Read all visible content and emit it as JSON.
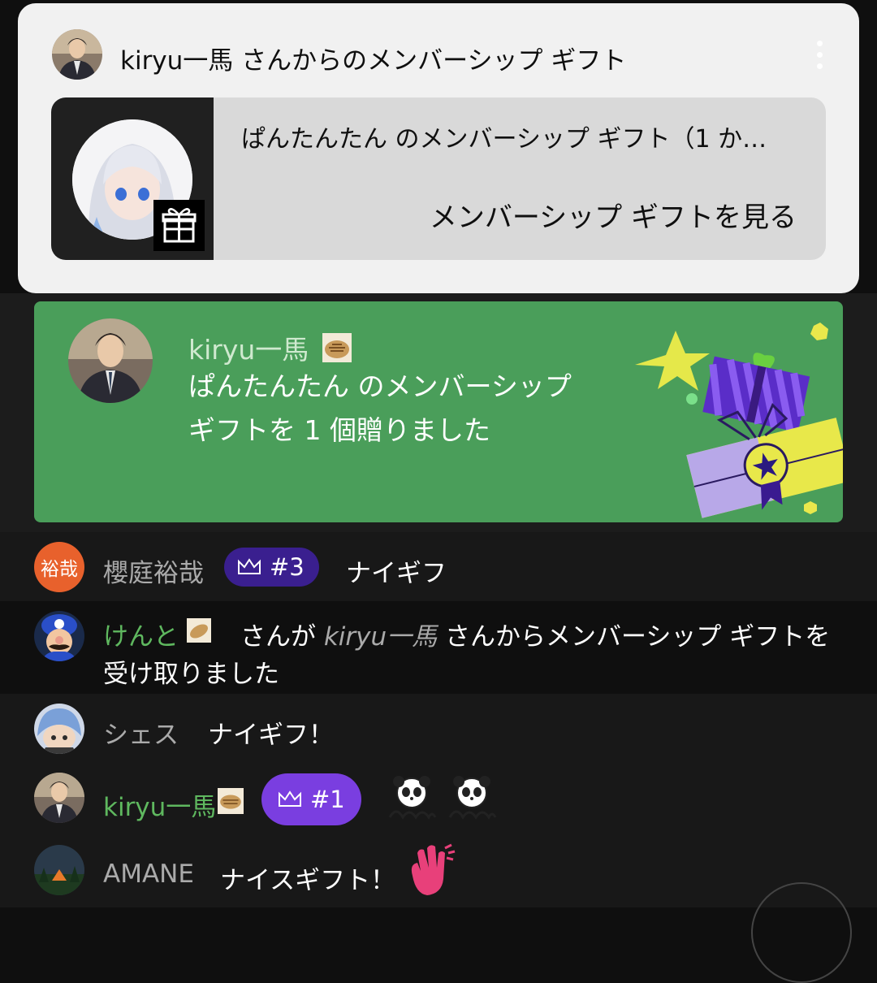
{
  "popup": {
    "title": "kiryu一馬 さんからのメンバーシップ ギフト",
    "gift_line": "ぱんたんたん のメンバーシップ ギフト（1 か…",
    "view_link": "メンバーシップ ギフトを見る"
  },
  "banner": {
    "author": "kiryu一馬",
    "message": "ぱんたんたん のメンバーシップ ギフトを 1 個贈りました"
  },
  "chat": [
    {
      "avatar_text": "裕哉",
      "author": "櫻庭裕哉",
      "rank": "#3",
      "message": "ナイギフ"
    },
    {
      "author": "けんと",
      "pre": "さんが",
      "gifter": "kiryu一馬",
      "post": "さんからメンバーシップ ギフトを",
      "post2": "受け取りました"
    },
    {
      "author": "シェス",
      "message": "ナイギフ！"
    },
    {
      "author": "kiryu一馬",
      "rank": "#1"
    },
    {
      "author": "AMANE",
      "message": "ナイスギフト！"
    }
  ],
  "colors": {
    "banner_green": "#4a9e5a",
    "rank3_purple": "#3a1f8f",
    "rank1_purple": "#7a3ee0",
    "member_green": "#5fb85f",
    "avatar_orange": "#e8612c"
  }
}
